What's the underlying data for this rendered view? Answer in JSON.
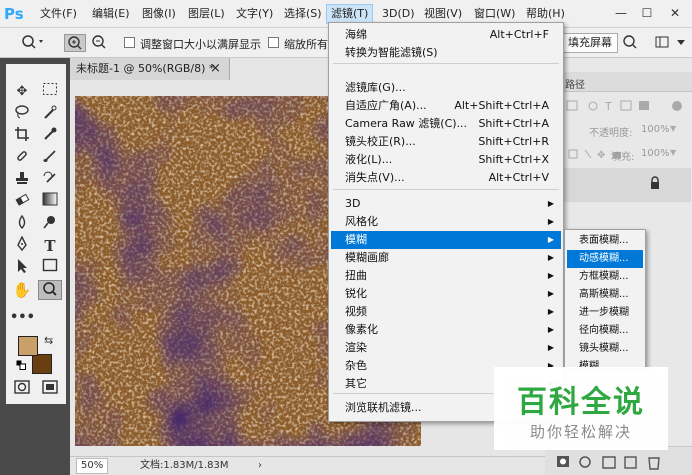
{
  "app": {
    "logo": "Ps"
  },
  "menubar": {
    "items": [
      "文件(F)",
      "编辑(E)",
      "图像(I)",
      "图层(L)",
      "文字(Y)",
      "选择(S)",
      "滤镜(T)",
      "3D(D)",
      "视图(V)",
      "窗口(W)",
      "帮助(H)"
    ],
    "active_index": 6,
    "window_buttons": [
      "—",
      "☐",
      "✕"
    ]
  },
  "options_bar": {
    "resize_window_label": "调整窗口大小以满屏显示",
    "zoom_all_label": "缩放所有",
    "fill_screen_label": "填充屏幕"
  },
  "document": {
    "tab_title": "未标题-1 @ 50%(RGB/8) *",
    "tab_close": "×",
    "zoom": "50%",
    "doc_info": "文档:1.83M/1.83M"
  },
  "right_panel": {
    "tab_label": "路径",
    "opacity_label": "不透明度:",
    "opacity_value": "100%",
    "fill_label": "填充:",
    "fill_value": "100%"
  },
  "filter_menu": {
    "items": [
      {
        "label": "海绵",
        "shortcut": "Alt+Ctrl+F"
      },
      {
        "label": "转换为智能滤镜(S)",
        "shortcut": ""
      },
      {
        "label": "滤镜库(G)...",
        "shortcut": ""
      },
      {
        "label": "自适应广角(A)...",
        "shortcut": "Alt+Shift+Ctrl+A"
      },
      {
        "label": "Camera Raw 滤镜(C)...",
        "shortcut": "Shift+Ctrl+A"
      },
      {
        "label": "镜头校正(R)...",
        "shortcut": "Shift+Ctrl+R"
      },
      {
        "label": "液化(L)...",
        "shortcut": "Shift+Ctrl+X"
      },
      {
        "label": "消失点(V)...",
        "shortcut": "Alt+Ctrl+V"
      },
      {
        "label": "3D",
        "submenu": true
      },
      {
        "label": "风格化",
        "submenu": true
      },
      {
        "label": "模糊",
        "submenu": true,
        "highlighted": true
      },
      {
        "label": "模糊画廊",
        "submenu": true
      },
      {
        "label": "扭曲",
        "submenu": true
      },
      {
        "label": "锐化",
        "submenu": true
      },
      {
        "label": "视频",
        "submenu": true
      },
      {
        "label": "像素化",
        "submenu": true
      },
      {
        "label": "渲染",
        "submenu": true
      },
      {
        "label": "杂色",
        "submenu": true
      },
      {
        "label": "其它",
        "submenu": true
      },
      {
        "label": "浏览联机滤镜...",
        "shortcut": ""
      }
    ]
  },
  "blur_submenu": {
    "items": [
      "表面模糊...",
      "动感模糊...",
      "方框模糊...",
      "高斯模糊...",
      "进一步模糊",
      "径向模糊...",
      "镜头模糊...",
      "模糊"
    ],
    "highlighted_index": 1
  },
  "watermark": {
    "title": "百科全说",
    "subtitle": "助你轻松解决"
  },
  "colors": {
    "menu_highlight": "#0078d7",
    "foreground_color": "#c9a06a",
    "background_color": "#6b3e12",
    "watermark_green": "#2aa63c"
  }
}
